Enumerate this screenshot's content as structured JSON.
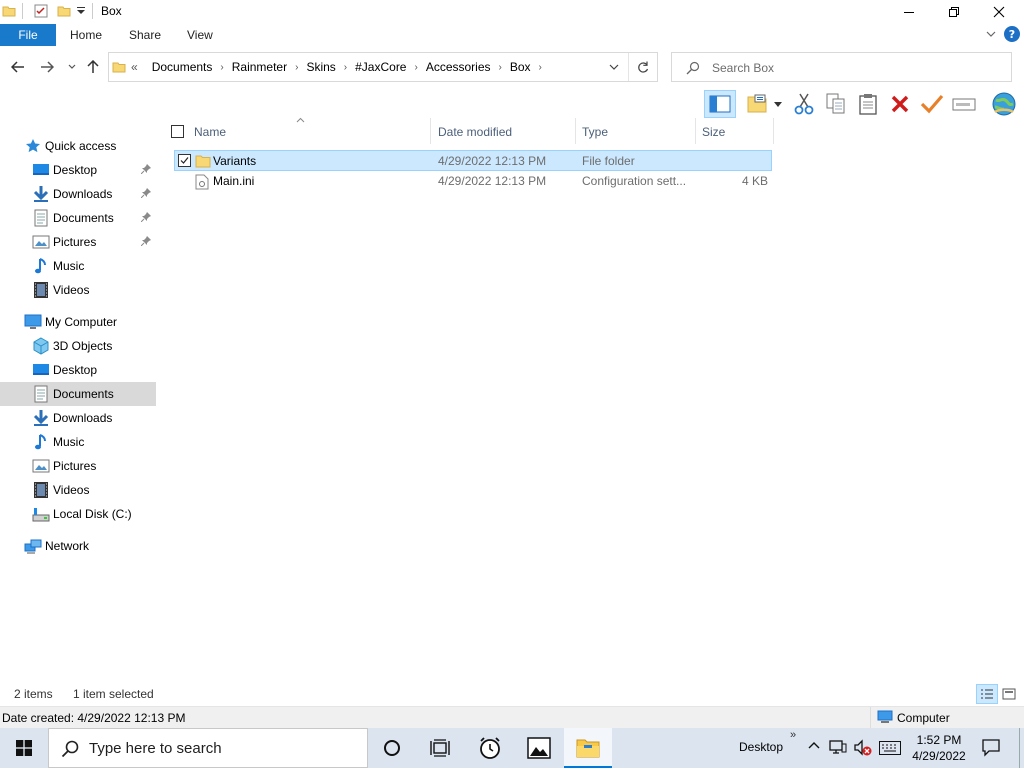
{
  "window": {
    "title": "Box"
  },
  "ribbon": {
    "file": "File",
    "tabs": [
      "Home",
      "Share",
      "View"
    ]
  },
  "address": {
    "overflow": "«",
    "crumbs": [
      "Documents",
      "Rainmeter",
      "Skins",
      "#JaxCore",
      "Accessories",
      "Box"
    ]
  },
  "search": {
    "placeholder": "Search Box"
  },
  "nav": {
    "quick_access": "Quick access",
    "quick_items": [
      "Desktop",
      "Downloads",
      "Documents",
      "Pictures",
      "Music",
      "Videos"
    ],
    "my_computer": "My Computer",
    "computer_items": [
      "3D Objects",
      "Desktop",
      "Documents",
      "Downloads",
      "Music",
      "Pictures",
      "Videos",
      "Local Disk (C:)"
    ],
    "network": "Network"
  },
  "columns": {
    "name": "Name",
    "date": "Date modified",
    "type": "Type",
    "size": "Size"
  },
  "files": [
    {
      "name": "Variants",
      "date": "4/29/2022 12:13 PM",
      "type": "File folder",
      "size": ""
    },
    {
      "name": "Main.ini",
      "date": "4/29/2022 12:13 PM",
      "type": "Configuration sett...",
      "size": "4 KB"
    }
  ],
  "status": {
    "items": "2 items",
    "selected": "1 item selected",
    "date_created": "Date created: 4/29/2022 12:13 PM",
    "zone": "Computer"
  },
  "taskbar": {
    "search_placeholder": "Type here to search",
    "desktop_label": "Desktop",
    "overflow_label": "»",
    "time": "1:52 PM",
    "date": "4/29/2022"
  },
  "colors": {
    "accent": "#1979ca",
    "selection": "#cce8ff",
    "folder": "#f8d775"
  }
}
